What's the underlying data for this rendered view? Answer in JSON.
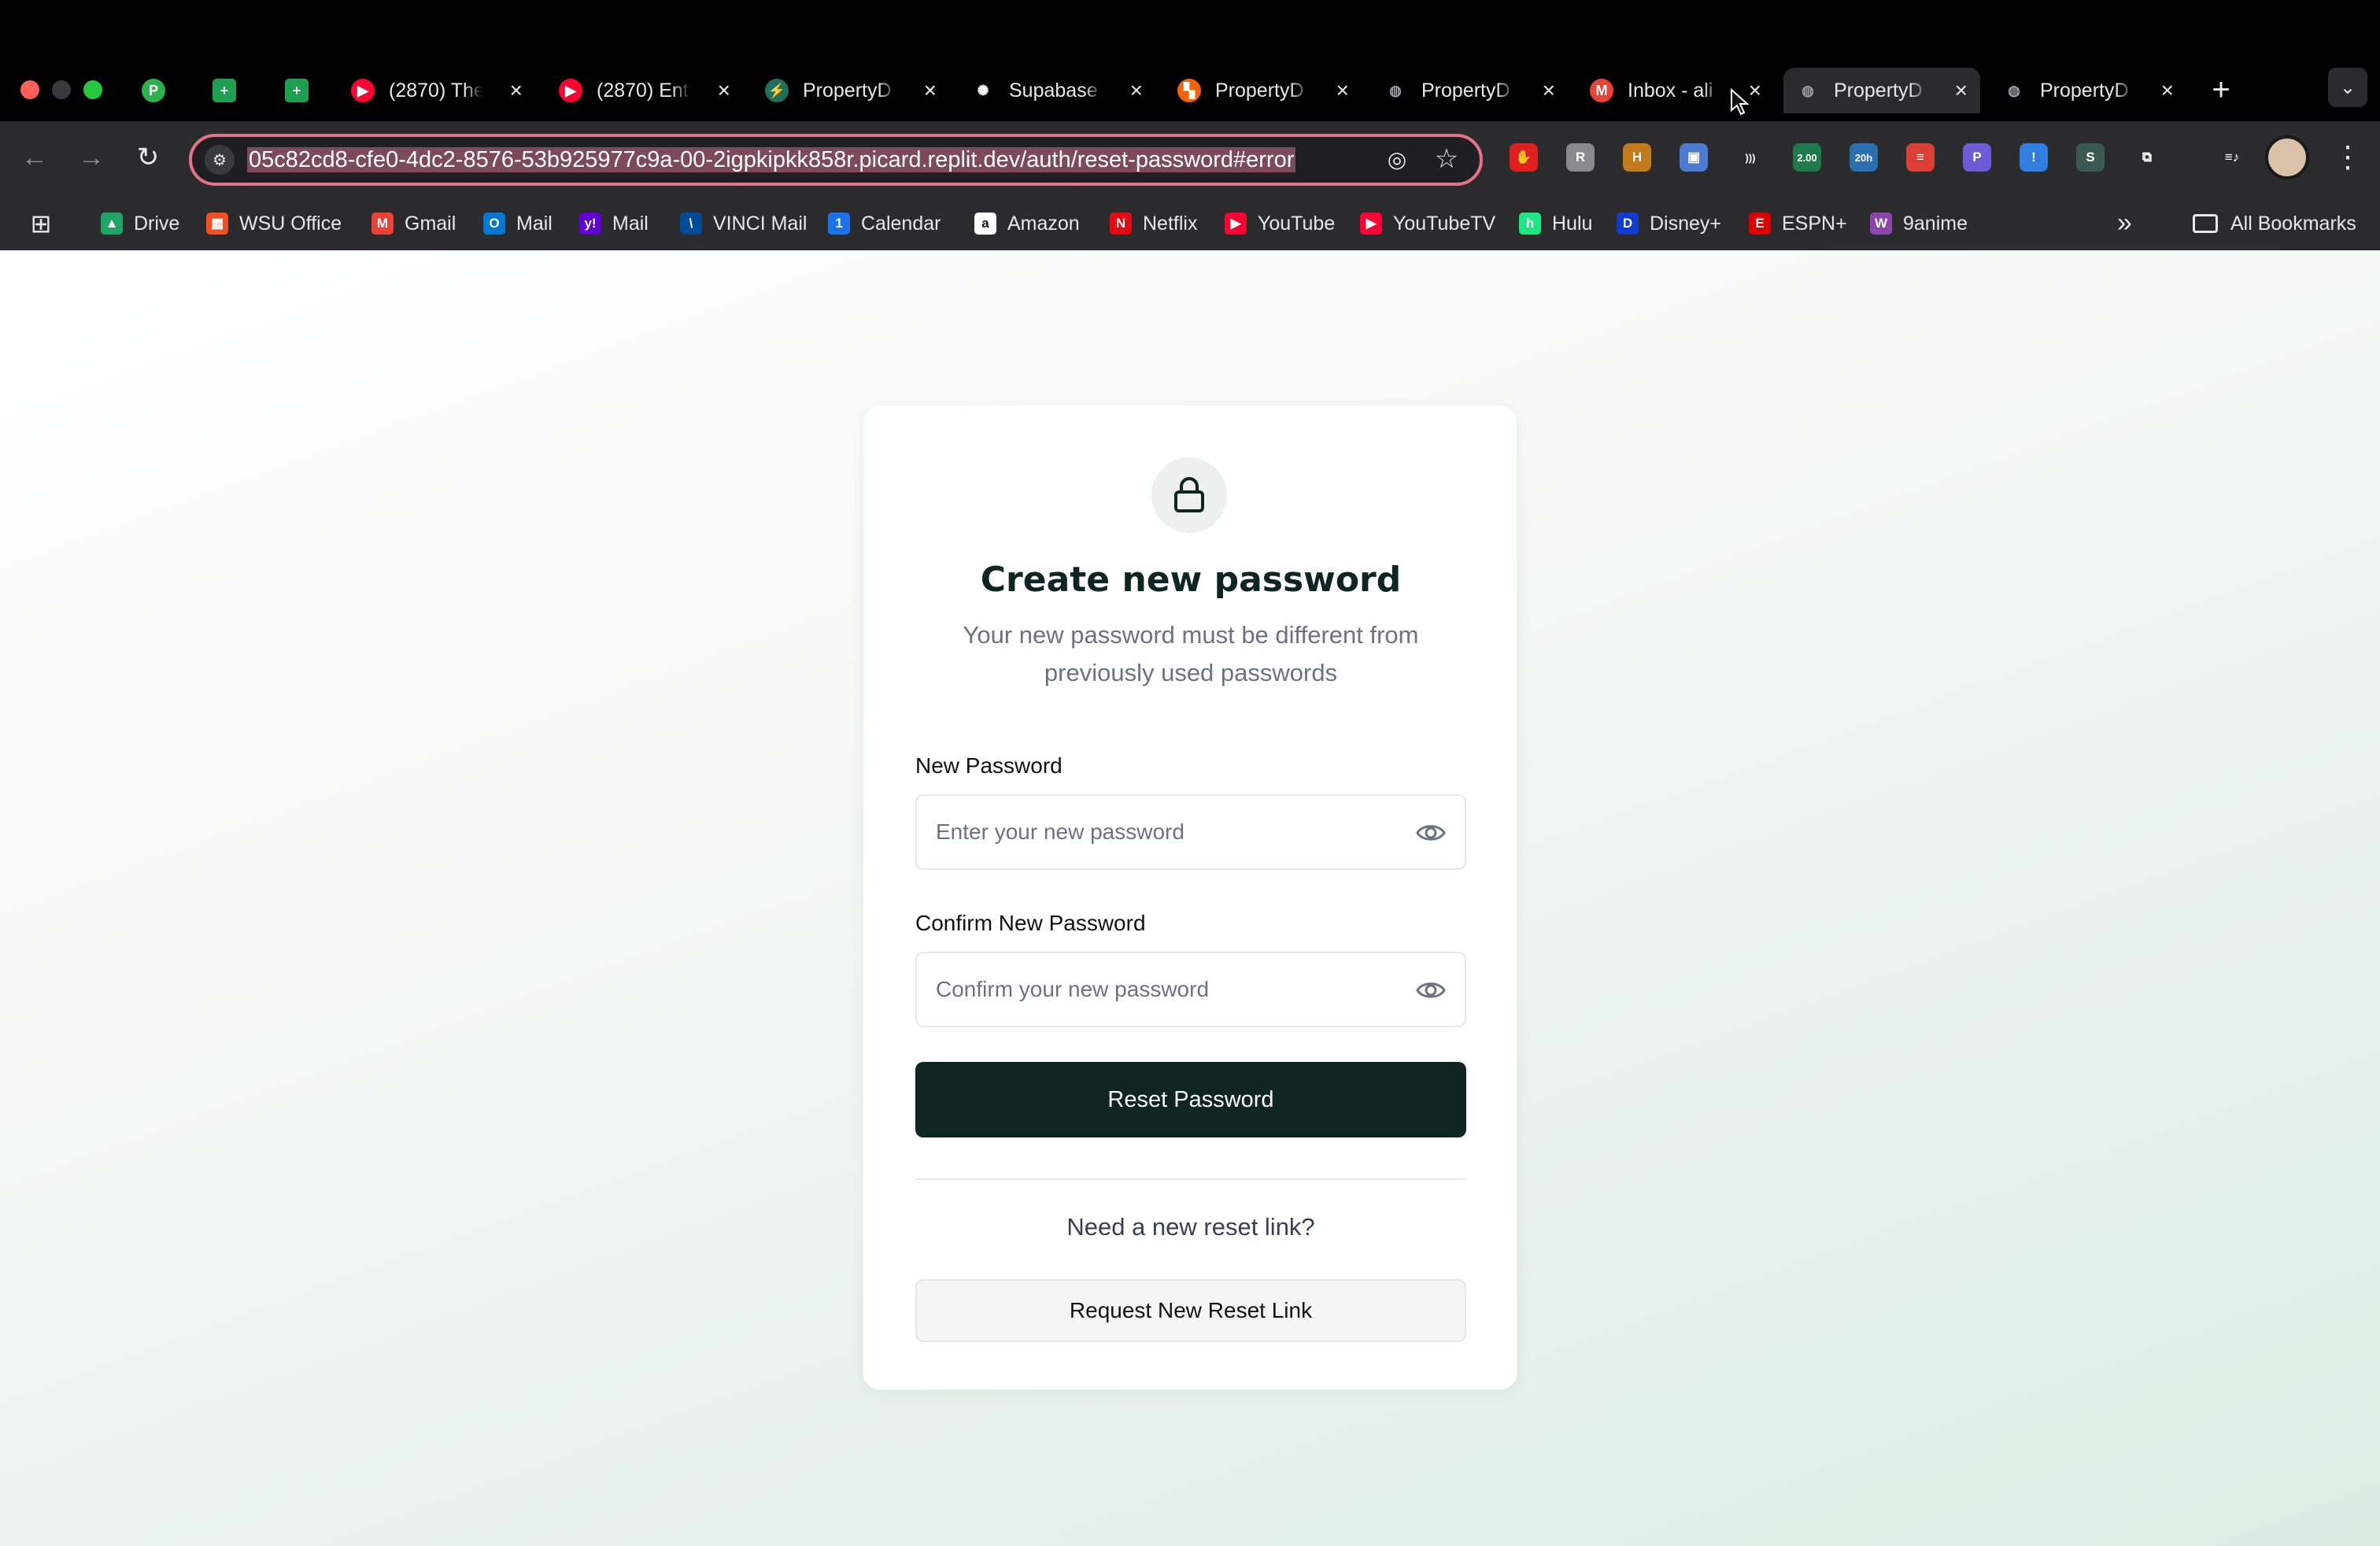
{
  "browser": {
    "tabs": [
      {
        "title": "",
        "icon": "producthunt-icon",
        "color": "#2bb24c",
        "glyph": "P"
      },
      {
        "title": "",
        "icon": "google-sheets-icon",
        "color": "#1e9e4f",
        "glyph": "+"
      },
      {
        "title": "",
        "icon": "google-sheets-icon",
        "color": "#1e9e4f",
        "glyph": "+"
      },
      {
        "title": "(2870) The",
        "icon": "youtube-icon",
        "color": "#ff0033",
        "glyph": "▶"
      },
      {
        "title": "(2870) Ent",
        "icon": "youtube-icon",
        "color": "#ff0033",
        "glyph": "▶"
      },
      {
        "title": "PropertyD",
        "icon": "bolt-icon",
        "color": "#1f6f5c",
        "glyph": "⚡"
      },
      {
        "title": "Supabase",
        "icon": "openai-icon",
        "color": "#ffffff",
        "glyph": "✺"
      },
      {
        "title": "PropertyD",
        "icon": "replit-icon",
        "color": "#f26207",
        "glyph": "▚"
      },
      {
        "title": "PropertyD",
        "icon": "globe-icon",
        "color": "#9aa0a6",
        "glyph": "◍"
      },
      {
        "title": "Inbox - ali",
        "icon": "gmail-icon",
        "color": "#ea4335",
        "glyph": "M"
      },
      {
        "title": "PropertyD",
        "icon": "globe-icon",
        "color": "#9aa0a6",
        "glyph": "◍"
      },
      {
        "title": "PropertyD",
        "icon": "globe-icon",
        "color": "#9aa0a6",
        "glyph": "◍"
      }
    ],
    "active_tab_index": 10,
    "url": "05c82cd8-cfe0-4dc2-8576-53b925977c9a-00-2igpkipkk858r.picard.replit.dev/auth/reset-password#error",
    "extensions": [
      {
        "name": "adblock-icon",
        "color": "#e02020",
        "glyph": "✋"
      },
      {
        "name": "extension-a-icon",
        "color": "#8a8a8a",
        "glyph": "R"
      },
      {
        "name": "extension-b-icon",
        "color": "#c27a1a",
        "glyph": "H"
      },
      {
        "name": "extension-c-icon",
        "color": "#4a7bd0",
        "glyph": "▣"
      },
      {
        "name": "extension-d-icon",
        "color": "#2b2b2d",
        "glyph": ")))"
      },
      {
        "name": "speed-extension-icon",
        "color": "#1e7a4a",
        "glyph": "2.00"
      },
      {
        "name": "timer-extension-icon",
        "color": "#2a6fb0",
        "glyph": "20h"
      },
      {
        "name": "todoist-icon",
        "color": "#db4035",
        "glyph": "≡"
      },
      {
        "name": "extension-e-icon",
        "color": "#6d5ad6",
        "glyph": "P"
      },
      {
        "name": "extension-f-icon",
        "color": "#2f7ee0",
        "glyph": "!"
      },
      {
        "name": "extension-g-icon",
        "color": "#3a5a50",
        "glyph": "S"
      },
      {
        "name": "puzzle-icon",
        "color": "#2b2b2d",
        "glyph": "⧉"
      },
      {
        "name": "media-icon",
        "color": "#2b2b2d",
        "glyph": "≡♪"
      }
    ],
    "bookmarks": [
      {
        "label": "Drive",
        "icon": "google-drive-icon",
        "color": "#1fa463",
        "glyph": "▲"
      },
      {
        "label": "WSU Office",
        "icon": "microsoft-icon",
        "color": "#f25022",
        "glyph": "▦"
      },
      {
        "label": "Gmail",
        "icon": "gmail-icon",
        "color": "#ea4335",
        "glyph": "M"
      },
      {
        "label": "Mail",
        "icon": "outlook-icon",
        "color": "#0078d4",
        "glyph": "O"
      },
      {
        "label": "Mail",
        "icon": "yahoo-icon",
        "color": "#6001d2",
        "glyph": "y!"
      },
      {
        "label": "VINCI Mail",
        "icon": "vinci-icon",
        "color": "#004a99",
        "glyph": "\\"
      },
      {
        "label": "Calendar",
        "icon": "calendar-icon",
        "color": "#1a73e8",
        "glyph": "1"
      },
      {
        "label": "Amazon",
        "icon": "amazon-icon",
        "color": "#ffffff",
        "glyph": "a"
      },
      {
        "label": "Netflix",
        "icon": "netflix-icon",
        "color": "#e50914",
        "glyph": "N"
      },
      {
        "label": "YouTube",
        "icon": "youtube-icon",
        "color": "#ff0033",
        "glyph": "▶"
      },
      {
        "label": "YouTubeTV",
        "icon": "youtube-tv-icon",
        "color": "#ff0033",
        "glyph": "▶"
      },
      {
        "label": "Hulu",
        "icon": "hulu-icon",
        "color": "#1ce783",
        "glyph": "h"
      },
      {
        "label": "Disney+",
        "icon": "disney-icon",
        "color": "#113ccf",
        "glyph": "D"
      },
      {
        "label": "ESPN+",
        "icon": "espn-icon",
        "color": "#d00",
        "glyph": "E"
      },
      {
        "label": "9anime",
        "icon": "9anime-icon",
        "color": "#8e44ad",
        "glyph": "W"
      }
    ],
    "all_bookmarks_label": "All Bookmarks"
  },
  "page": {
    "title": "Create new password",
    "subtitle": "Your new password must be different from previously used passwords",
    "new_password": {
      "label": "New Password",
      "placeholder": "Enter your new password",
      "value": ""
    },
    "confirm_password": {
      "label": "Confirm New Password",
      "placeholder": "Confirm your new password",
      "value": ""
    },
    "reset_button": "Reset Password",
    "need_link_text": "Need a new reset link?",
    "request_button": "Request New Reset Link"
  },
  "colors": {
    "primary": "#0f2620",
    "url_border": "#e3728a"
  }
}
